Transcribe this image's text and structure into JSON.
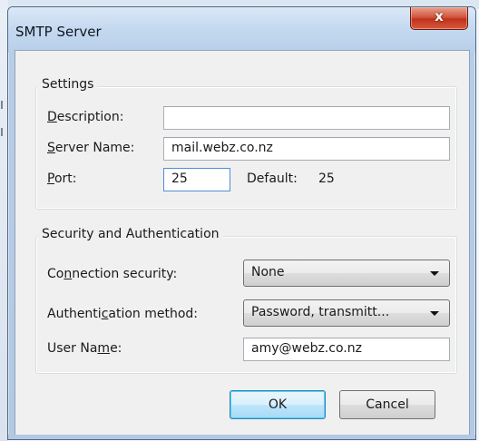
{
  "window": {
    "title": "SMTP Server",
    "close_glyph": "x"
  },
  "settings": {
    "legend": "Settings",
    "description": {
      "label_key": "D",
      "label_rest": "escription:",
      "value": ""
    },
    "server_name": {
      "label_key": "S",
      "label_rest": "erver Name:",
      "value": "mail.webz.co.nz"
    },
    "port": {
      "label_key": "P",
      "label_rest": "ort:",
      "value": "25"
    },
    "default_label": "Default:",
    "default_value": "25"
  },
  "security": {
    "legend": "Security and Authentication",
    "connection": {
      "label_pre": "Co",
      "label_key": "n",
      "label_post": "nection security:",
      "value": "None"
    },
    "auth_method": {
      "label_pre": "Authenti",
      "label_key": "c",
      "label_post": "ation method:",
      "value": "Password, transmitt..."
    },
    "user_name": {
      "label_pre": "User Na",
      "label_key": "m",
      "label_post": "e:",
      "value": "amy@webz.co.nz"
    }
  },
  "buttons": {
    "ok": "OK",
    "cancel": "Cancel"
  },
  "colors": {
    "titlebar": "#c5d9f0",
    "close_button": "#c1321c",
    "client_bg": "#f0f0f0",
    "default_button": "#bee6fd"
  },
  "icons": {
    "close": "close-icon",
    "dropdown": "chevron-down-icon"
  }
}
